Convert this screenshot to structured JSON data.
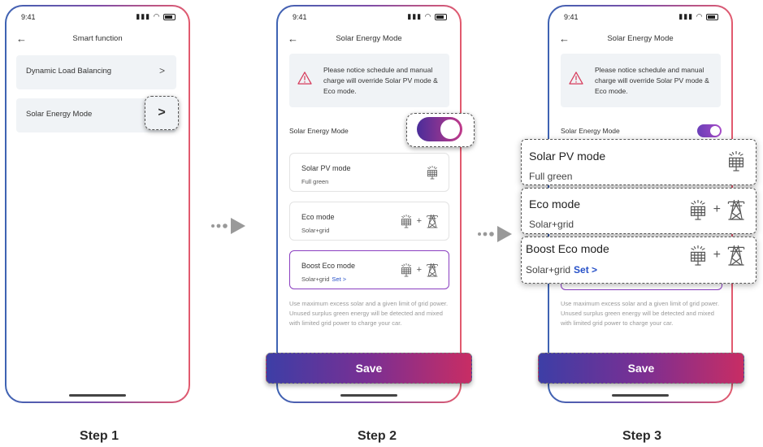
{
  "status_time": "9:41",
  "step1": {
    "title": "Smart function",
    "items": [
      {
        "label": "Dynamic Load Balancing"
      },
      {
        "label": "Solar Energy Mode"
      }
    ],
    "chevron": ">"
  },
  "step2": {
    "title": "Solar Energy Mode",
    "notice": "Please notice schedule and manual charge will override Solar PV mode & Eco mode.",
    "toggle_label": "Solar Energy Mode",
    "toggle_on": true,
    "modes": [
      {
        "title": "Solar PV mode",
        "sub": "Full green",
        "icons": [
          "solar-panel"
        ]
      },
      {
        "title": "Eco mode",
        "sub": "Solar+grid",
        "icons": [
          "solar-panel",
          "power-tower"
        ]
      },
      {
        "title": "Boost Eco mode",
        "sub": "Solar+grid",
        "link": "Set >",
        "icons": [
          "solar-panel",
          "power-tower"
        ],
        "selected": true
      }
    ],
    "description": "Use maximum excess solar and a given limit of grid power. Unused surplus green energy will be detected and mixed with limited grid power to charge your car.",
    "save": "Save"
  },
  "step3": {
    "title": "Solar Energy Mode",
    "notice": "Please notice schedule and manual charge will override Solar PV mode & Eco mode.",
    "toggle_label": "Solar Energy Mode",
    "modes": [
      {
        "title": "Solar PV mode",
        "sub": "Full green"
      },
      {
        "title": "Eco mode",
        "sub": "Solar+grid"
      },
      {
        "title": "Boost Eco mode",
        "sub": "Solar+grid",
        "link": "Set >"
      }
    ],
    "description": "Use maximum excess solar and a given limit of grid power. Unused surplus green energy will be detected and mixed with limited grid power to charge your car.",
    "save": "Save"
  },
  "plus": "+",
  "steps": [
    "Step 1",
    "Step 2",
    "Step 3"
  ],
  "colors": {
    "accent_start": "#3d3ea6",
    "accent_end": "#c82d64",
    "link": "#2650c8",
    "selected_border": "#8a3fc0"
  }
}
